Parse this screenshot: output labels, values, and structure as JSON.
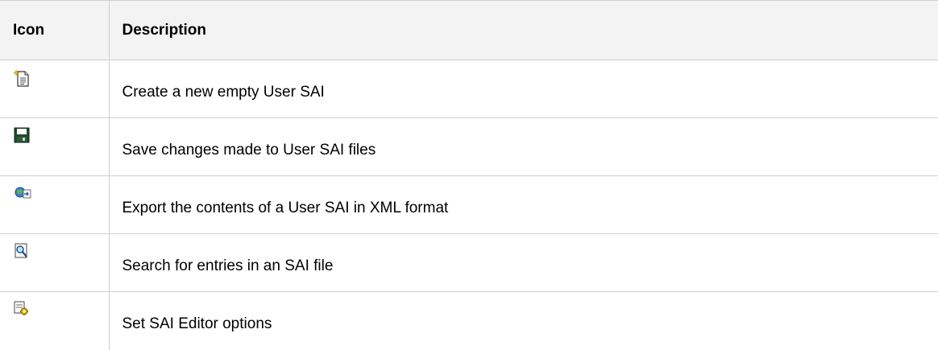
{
  "table": {
    "headers": {
      "icon": "Icon",
      "description": "Description"
    },
    "rows": [
      {
        "icon": "new-document-icon",
        "description": "Create a new empty User SAI"
      },
      {
        "icon": "floppy-disk-save-icon",
        "description": "Save changes made to User SAI files"
      },
      {
        "icon": "export-xml-icon",
        "description": "Export the contents of a User SAI in XML format"
      },
      {
        "icon": "magnifier-search-icon",
        "description": "Search for entries in an SAI file"
      },
      {
        "icon": "options-gear-icon",
        "description": "Set SAI Editor options"
      }
    ]
  },
  "colors": {
    "header_background": "#f3f3f3",
    "border": "#cfcfcf",
    "text": "#000000"
  }
}
